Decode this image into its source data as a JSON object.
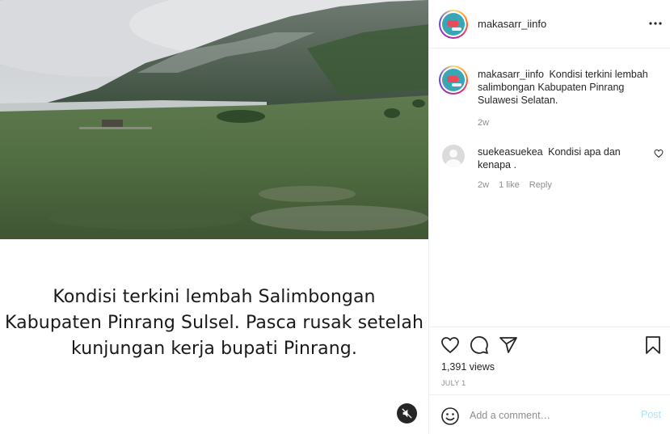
{
  "video": {
    "overlay_text": [
      "Kondisi terkini lembah Salimbongan",
      "Kabupaten Pinrang Sulsel. Pasca rusak setelah",
      "kunjungan kerja bupati Pinrang."
    ]
  },
  "header": {
    "username": "makasarr_iinfo"
  },
  "caption": {
    "username": "makasarr_iinfo",
    "text": "Kondisi terkini lembah salimbongan Kabupaten Pinrang Sulawesi Selatan.",
    "time": "2w"
  },
  "comments": [
    {
      "username": "suekeasuekea",
      "text": "Kondisi apa dan kenapa .",
      "time": "2w",
      "likes": "1 like",
      "reply": "Reply"
    }
  ],
  "stats": {
    "views": "1,391 views",
    "date": "JULY 1"
  },
  "add_comment": {
    "placeholder": "Add a comment…",
    "post_label": "Post"
  },
  "colors": {
    "accent_disabled": "#b2dffc",
    "muted_text": "#8e8e8e",
    "border": "#efefef"
  },
  "icons": [
    "more-icon",
    "heart-icon",
    "comment-icon",
    "share-icon",
    "bookmark-icon",
    "emoji-icon",
    "mute-icon"
  ]
}
